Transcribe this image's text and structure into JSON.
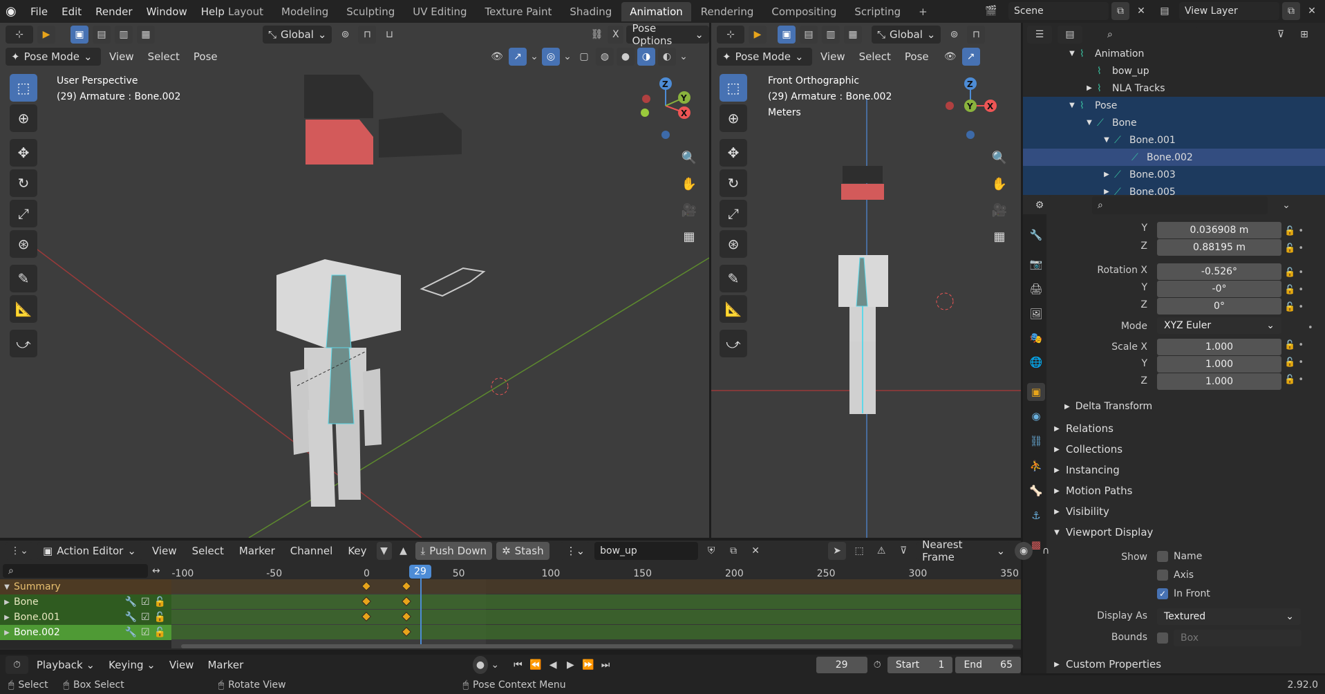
{
  "topbar": {
    "menus": [
      "File",
      "Edit",
      "Render",
      "Window",
      "Help"
    ],
    "workspaces": [
      "Layout",
      "Modeling",
      "Sculpting",
      "UV Editing",
      "Texture Paint",
      "Shading",
      "Animation",
      "Rendering",
      "Compositing",
      "Scripting"
    ],
    "active_workspace": "Animation",
    "add_tab": "+",
    "scene": "Scene",
    "view_layer": "View Layer"
  },
  "vp1": {
    "transform": "Global",
    "pose_options": "Pose Options",
    "x_label": "X",
    "mode": "Pose Mode",
    "menus": [
      "View",
      "Select",
      "Pose"
    ],
    "perspective": "User Perspective",
    "object": "(29) Armature : Bone.002"
  },
  "vp2": {
    "transform": "Global",
    "mode": "Pose Mode",
    "menus": [
      "View",
      "Select",
      "Pose"
    ],
    "perspective": "Front Orthographic",
    "object": "(29) Armature : Bone.002",
    "units": "Meters"
  },
  "gizmo": {
    "x": "X",
    "y": "Y",
    "z": "Z"
  },
  "outliner": {
    "items": [
      {
        "label": "Animation",
        "indent": 4,
        "arrow": "▼"
      },
      {
        "label": "bow_up",
        "indent": 5,
        "arrow": ""
      },
      {
        "label": "NLA Tracks",
        "indent": 5,
        "arrow": "▶"
      },
      {
        "label": "Pose",
        "indent": 4,
        "arrow": "▼"
      },
      {
        "label": "Bone",
        "indent": 5,
        "arrow": "▼"
      },
      {
        "label": "Bone.001",
        "indent": 6,
        "arrow": "▼"
      },
      {
        "label": "Bone.002",
        "indent": 7,
        "arrow": ""
      },
      {
        "label": "Bone.003",
        "indent": 6,
        "arrow": "▶"
      },
      {
        "label": "Bone.005",
        "indent": 6,
        "arrow": "▶"
      }
    ]
  },
  "properties": {
    "location": {
      "label_y": "Y",
      "y": "0.036908 m",
      "label_z": "Z",
      "z": "0.88195 m"
    },
    "rotation": {
      "label_x": "Rotation X",
      "x": "-0.526°",
      "label_y": "Y",
      "y": "-0°",
      "label_z": "Z",
      "z": "0°"
    },
    "mode_label": "Mode",
    "mode": "XYZ Euler",
    "scale": {
      "label_x": "Scale X",
      "x": "1.000",
      "label_y": "Y",
      "y": "1.000",
      "label_z": "Z",
      "z": "1.000"
    },
    "delta": "Delta Transform",
    "panels": [
      "Relations",
      "Collections",
      "Instancing",
      "Motion Paths",
      "Visibility",
      "Viewport Display"
    ],
    "show_label": "Show",
    "name_label": "Name",
    "axis_label": "Axis",
    "infront_label": "In Front",
    "display_as_label": "Display As",
    "display_as": "Textured",
    "bounds_label": "Bounds",
    "bounds_value": "Box",
    "custom_props": "Custom Properties"
  },
  "action_editor": {
    "editor": "Action Editor",
    "menus": [
      "View",
      "Select",
      "Marker",
      "Channel",
      "Key"
    ],
    "push_down": "Push Down",
    "stash": "Stash",
    "action": "bow_up",
    "snap": "Nearest Frame",
    "ticks": [
      "-100",
      "-50",
      "0",
      "29",
      "50",
      "100",
      "150",
      "200",
      "250",
      "300",
      "350"
    ],
    "current_frame": 29,
    "channels": [
      "Summary",
      "Bone",
      "Bone.001",
      "Bone.002"
    ]
  },
  "timeline": {
    "menus": [
      "Playback",
      "Keying",
      "View",
      "Marker"
    ],
    "frame": "29",
    "start_label": "Start",
    "start": "1",
    "end_label": "End",
    "end": "65"
  },
  "statusbar": {
    "select": "Select",
    "box_select": "Box Select",
    "rotate_view": "Rotate View",
    "pose_context": "Pose Context Menu",
    "version": "2.92.0"
  },
  "colors": {
    "accent": "#4772b3",
    "keyframe": "#e7a41b",
    "channel_green": "#2f5b20",
    "summary": "#4d3a23",
    "playhead": "#4d8cd6"
  }
}
